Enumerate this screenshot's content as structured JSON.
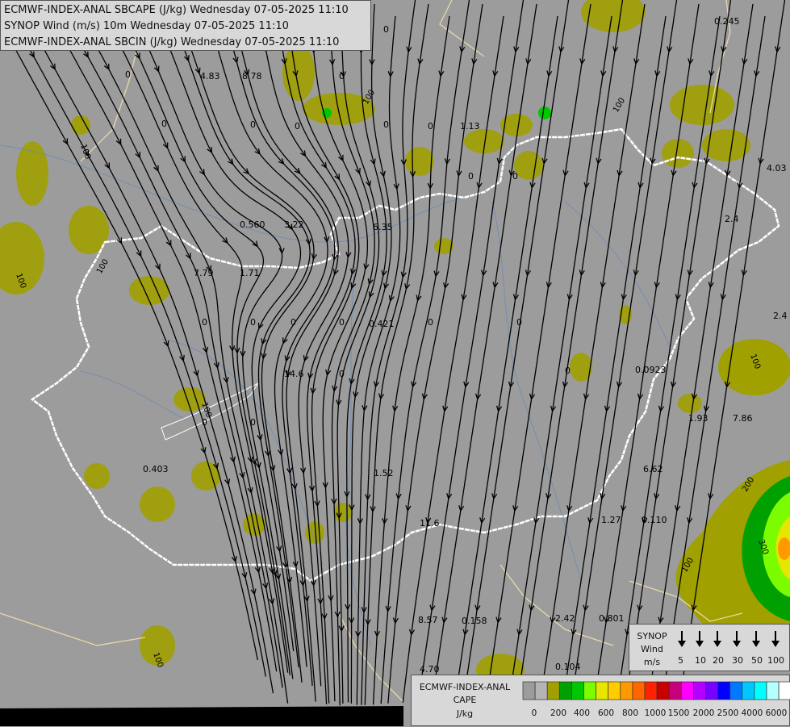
{
  "header": {
    "line1": "ECMWF-INDEX-ANAL SBCAPE (J/kg) Wednesday 07-05-2025 11:10",
    "line2": "SYNOP Wind (m/s) 10m Wednesday 07-05-2025 11:10",
    "line3": "ECMWF-INDEX-ANAL SBCIN (J/kg) Wednesday 07-05-2025 11:10"
  },
  "wind_legend": {
    "title_line1": "SYNOP",
    "title_line2": "Wind",
    "unit": "m/s",
    "speeds": [
      "5",
      "10",
      "20",
      "30",
      "50",
      "100"
    ]
  },
  "cape_legend": {
    "title_line1": "ECMWF-INDEX-ANAL",
    "title_line2": "CAPE",
    "unit": "J/kg",
    "ticks": [
      "0",
      "200",
      "400",
      "600",
      "800",
      "1000",
      "1500",
      "2000",
      "2500",
      "4000",
      "6000"
    ],
    "colors": [
      "#9c9c9c",
      "#b4b4b4",
      "#a0a000",
      "#00a000",
      "#00c800",
      "#7cfc00",
      "#e6e600",
      "#ffcc00",
      "#ff9900",
      "#ff6600",
      "#ff2200",
      "#c80000",
      "#c8007c",
      "#ff00ff",
      "#b400ff",
      "#7800ff",
      "#0000ff",
      "#0078ff",
      "#00c8ff",
      "#00ffff",
      "#b4ffff",
      "#ffffff"
    ]
  },
  "map_labels": [
    "0.245",
    "4.83",
    "8.78",
    "1.13",
    "4.03",
    "2.4",
    "0.560",
    "3.22",
    "6.35",
    "7.79",
    "1.71",
    "0.421",
    "2.4",
    "14.6",
    "0.0923",
    "1.93",
    "7.86",
    "0.403",
    "1.52",
    "6.62",
    "11.6",
    "1.27",
    "0.110",
    "8.57",
    "0.158",
    "2.42",
    "0.801",
    "4.70",
    "0.104",
    "0",
    "0",
    "0",
    "0",
    "0",
    "0",
    "0",
    "0",
    "0",
    "0",
    "0",
    "0",
    "0",
    "0",
    "0",
    "0",
    "0",
    "0",
    "0",
    "0",
    "100",
    "100",
    "100",
    "100",
    "100",
    "100",
    "100",
    "100",
    "100",
    "200",
    "300"
  ]
}
